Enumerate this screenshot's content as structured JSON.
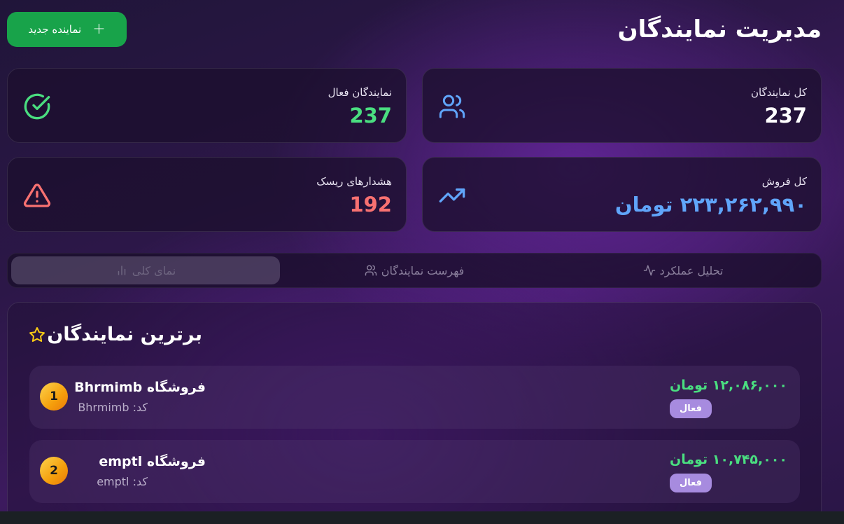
{
  "header": {
    "title": "مدیریت نمایندگان",
    "new_button_label": "نماینده جدید"
  },
  "stats": {
    "total": {
      "label": "کل نمایندگان",
      "value": "237",
      "icon": "users-icon"
    },
    "active": {
      "label": "نمایندگان فعال",
      "value": "237",
      "icon": "check-circle-icon"
    },
    "sales": {
      "label": "کل فروش",
      "value": "۲۲۳,۲۶۲,۹۹۰ تومان",
      "icon": "trending-up-icon"
    },
    "risk": {
      "label": "هشدارهای ریسک",
      "value": "192",
      "icon": "warning-icon"
    }
  },
  "tabs": [
    {
      "label": "تحلیل عملکرد",
      "icon": "activity-icon",
      "active": false
    },
    {
      "label": "فهرست نمایندگان",
      "icon": "users-icon",
      "active": false
    },
    {
      "label": "نمای کلی",
      "icon": "bar-chart-icon",
      "active": true
    }
  ],
  "top_reps": {
    "title": "برترین نمایندگان",
    "items": [
      {
        "rank": "1",
        "name": "فروشگاه Bhrmimb",
        "code": "کد: Bhrmimb",
        "sales": "۱۲,۰۸۶,۰۰۰ تومان",
        "status": "فعال"
      },
      {
        "rank": "2",
        "name": "فروشگاه emptl",
        "code": "کد: emptl",
        "sales": "۱۰,۷۴۵,۰۰۰ تومان",
        "status": "فعال"
      }
    ]
  },
  "colors": {
    "accent_green": "#18a34a",
    "success": "#4ade80",
    "danger": "#f87171",
    "info": "#60a5fa",
    "badge": "#a78bdf"
  }
}
